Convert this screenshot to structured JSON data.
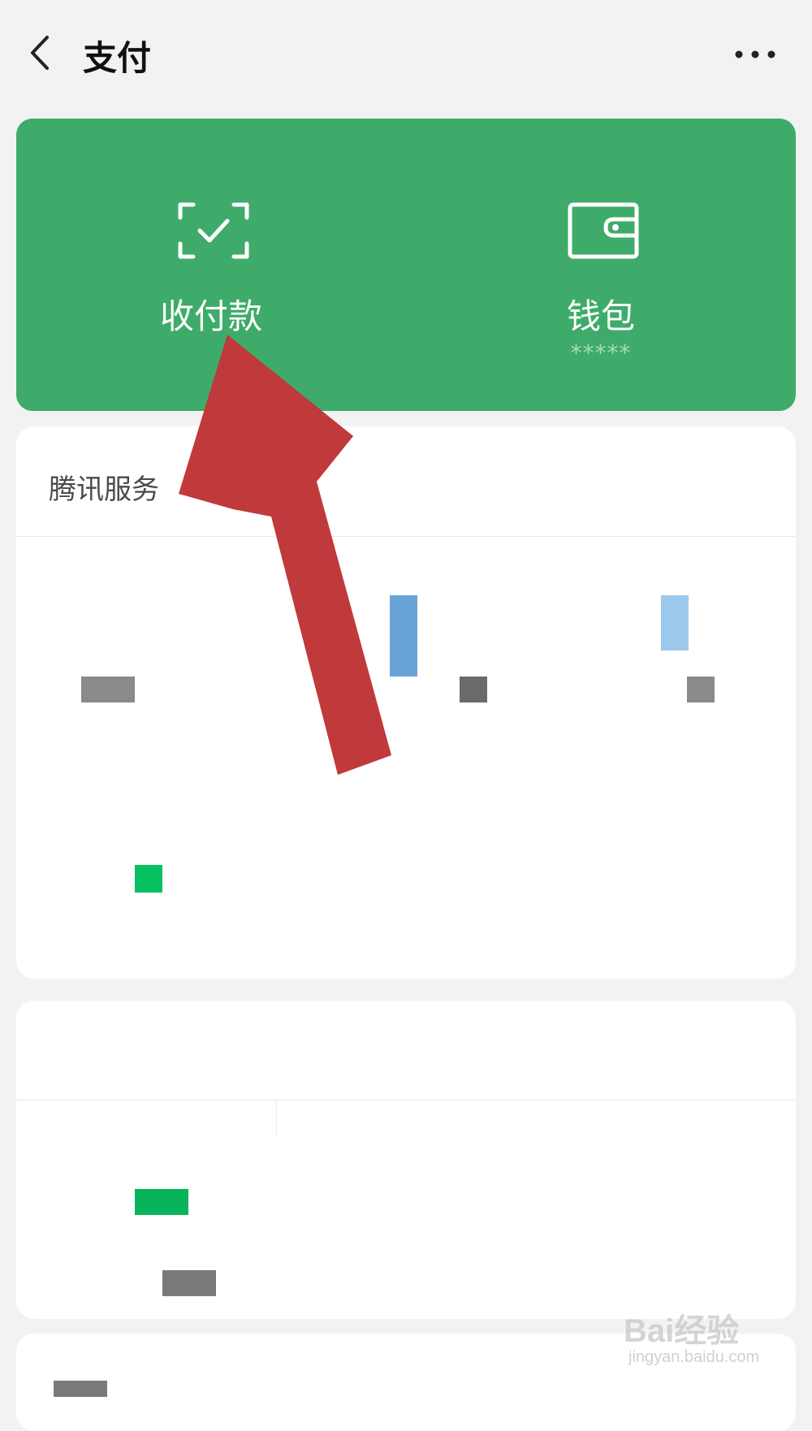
{
  "header": {
    "title": "支付",
    "back_icon": "chevron-left-icon",
    "more_icon": "more-horizontal-icon"
  },
  "pay_card": {
    "background": "#3eab6a",
    "items": [
      {
        "label": "收付款",
        "icon": "scan-check-icon"
      },
      {
        "label": "钱包",
        "sub": "*****",
        "icon": "wallet-icon"
      }
    ]
  },
  "services": {
    "header": "腾讯服务"
  },
  "annotation": {
    "arrow_color": "#c0393b"
  },
  "watermark": {
    "brand": "Bai经验",
    "url": "jingyan.baidu.com"
  }
}
